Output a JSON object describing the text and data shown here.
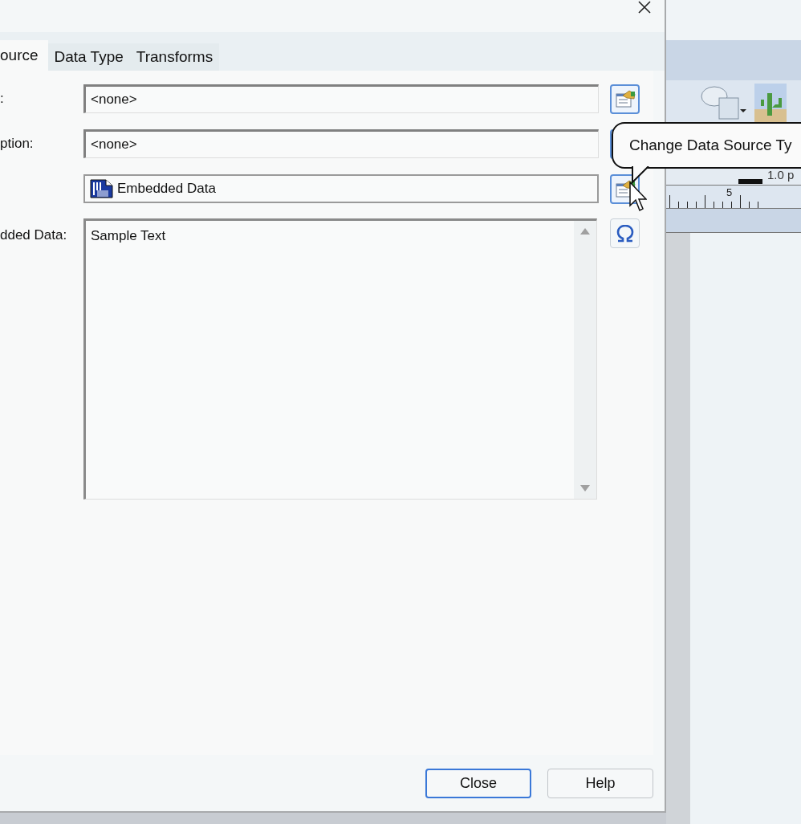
{
  "dialog": {
    "tabs": [
      {
        "label": "ource",
        "selected": true
      },
      {
        "label": "Data Type",
        "selected": false
      },
      {
        "label": "Transforms",
        "selected": false
      }
    ],
    "fields": [
      {
        "label": ":",
        "value": "<none>",
        "kind": "text"
      },
      {
        "label": "ption:",
        "value": "<none>",
        "kind": "text"
      },
      {
        "value": "Embedded Data",
        "kind": "source"
      }
    ],
    "embedded": {
      "label": "dded Data:",
      "value": "Sample Text"
    },
    "buttons": [
      {
        "label": "Close",
        "default": true
      },
      {
        "label": "Help",
        "default": false
      }
    ]
  },
  "tooltip": {
    "text": "Change Data Source Ty"
  },
  "background_app": {
    "line_width": "1.0 p",
    "ruler_label": "5"
  }
}
